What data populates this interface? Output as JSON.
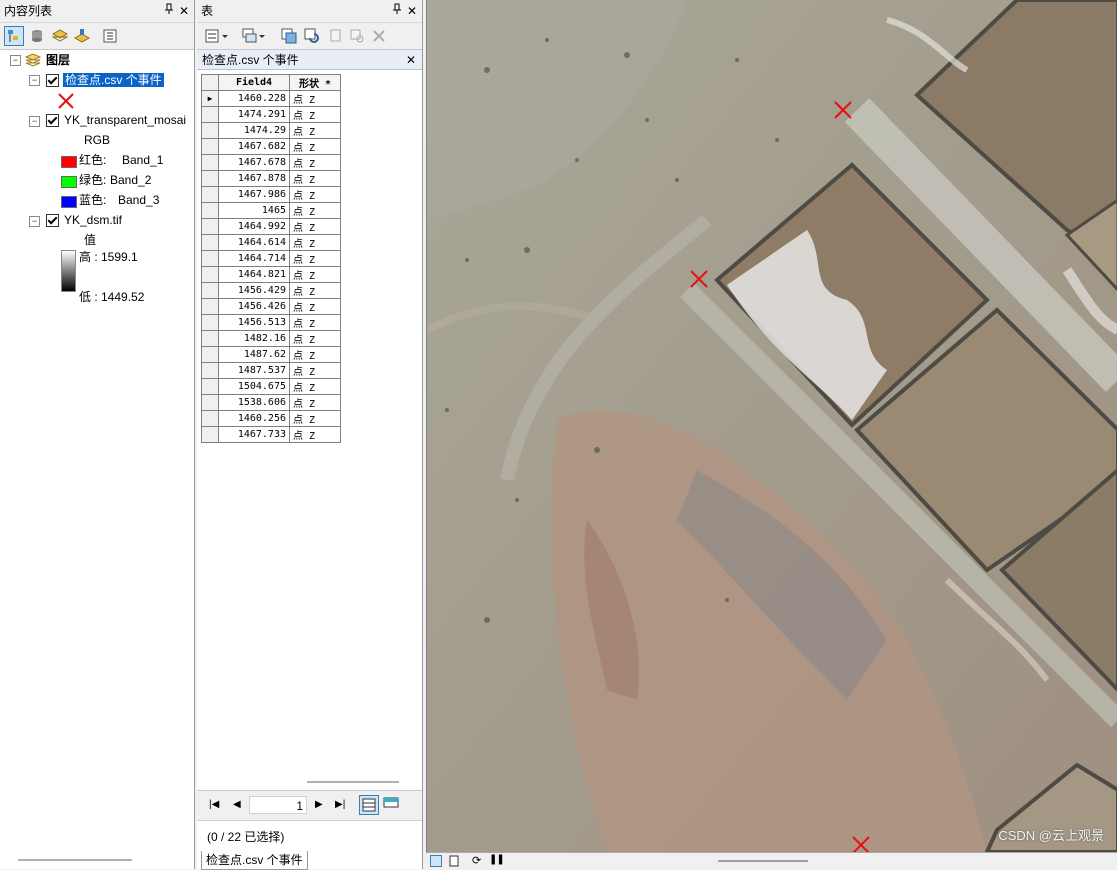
{
  "toc": {
    "title": "内容列表",
    "pin_icon": "pin-icon",
    "close_label": "✕",
    "root_label": "图层",
    "layers": [
      {
        "name": "检查点.csv 个事件",
        "checked": true,
        "selected": true,
        "symbol": "red-x-marker"
      },
      {
        "name": "YK_transparent_mosai",
        "checked": true,
        "sublabel": "RGB",
        "bands": [
          {
            "color": "#ff0000",
            "label": "红色:",
            "band": "Band_1"
          },
          {
            "color": "#00ff00",
            "label": "绿色:",
            "band": "Band_2"
          },
          {
            "color": "#0000ff",
            "label": "蓝色:",
            "band": "Band_3"
          }
        ]
      },
      {
        "name": "YK_dsm.tif",
        "checked": true,
        "value_label": "值",
        "high_label": "高 : 1599.1",
        "low_label": "低 : 1449.52"
      }
    ]
  },
  "table": {
    "title": "表",
    "tab_title": "检查点.csv 个事件",
    "columns": [
      "Field4",
      "形状 *"
    ],
    "rows": [
      [
        "1460.228",
        "点 Z"
      ],
      [
        "1474.291",
        "点 Z"
      ],
      [
        "1474.29",
        "点 Z"
      ],
      [
        "1467.682",
        "点 Z"
      ],
      [
        "1467.678",
        "点 Z"
      ],
      [
        "1467.878",
        "点 Z"
      ],
      [
        "1467.986",
        "点 Z"
      ],
      [
        "1465",
        "点 Z"
      ],
      [
        "1464.992",
        "点 Z"
      ],
      [
        "1464.614",
        "点 Z"
      ],
      [
        "1464.714",
        "点 Z"
      ],
      [
        "1464.821",
        "点 Z"
      ],
      [
        "1456.429",
        "点 Z"
      ],
      [
        "1456.426",
        "点 Z"
      ],
      [
        "1456.513",
        "点 Z"
      ],
      [
        "1482.16",
        "点 Z"
      ],
      [
        "1487.62",
        "点 Z"
      ],
      [
        "1487.537",
        "点 Z"
      ],
      [
        "1504.675",
        "点 Z"
      ],
      [
        "1538.606",
        "点 Z"
      ],
      [
        "1460.256",
        "点 Z"
      ],
      [
        "1467.733",
        "点 Z"
      ]
    ],
    "record_number": "1",
    "status": "(0 / 22 已选择)",
    "bottom_tab": "检查点.csv 个事件"
  },
  "map": {
    "marker_color": "#e81010",
    "watermark": "CSDN @云上观景"
  }
}
